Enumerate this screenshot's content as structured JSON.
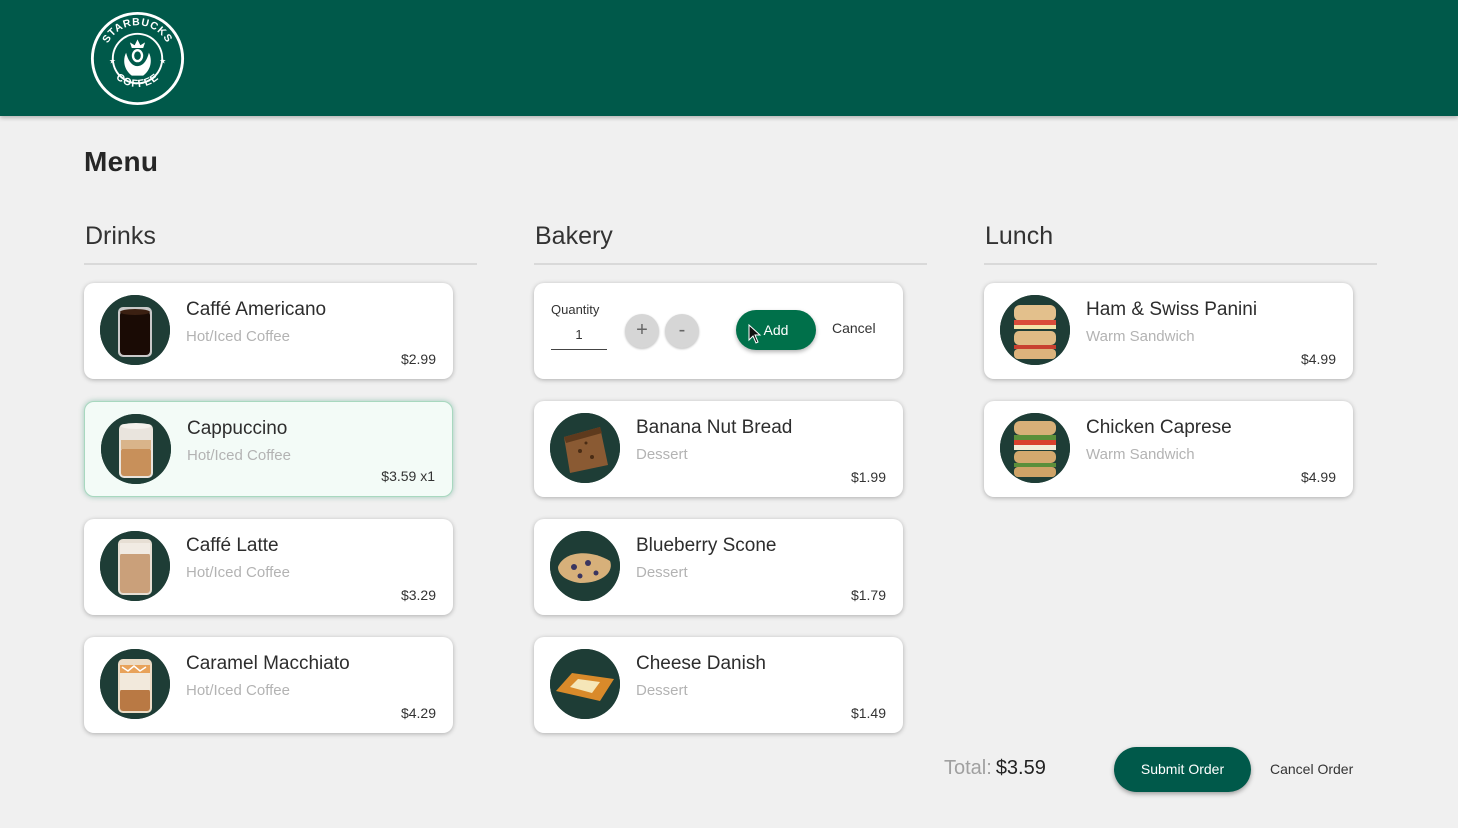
{
  "colors": {
    "header": "#00594a",
    "accent": "#00704a",
    "background": "#f0f0f0"
  },
  "header": {
    "logo_text_top": "STARBUCKS",
    "logo_text_bottom": "COFFEE"
  },
  "page_title": "Menu",
  "columns": [
    {
      "title": "Drinks",
      "items": [
        {
          "name": "Caffé Americano",
          "category": "Hot/Iced Coffee",
          "price": "$2.99",
          "icon": "americano-image"
        },
        {
          "name": "Cappuccino",
          "category": "Hot/Iced Coffee",
          "price": "$3.59 x1",
          "icon": "cappuccino-image",
          "selected": true
        },
        {
          "name": "Caffé Latte",
          "category": "Hot/Iced Coffee",
          "price": "$3.29",
          "icon": "latte-image"
        },
        {
          "name": "Caramel Macchiato",
          "category": "Hot/Iced Coffee",
          "price": "$4.29",
          "icon": "macchiato-image"
        }
      ]
    },
    {
      "title": "Bakery",
      "quantity_editor": {
        "label": "Quantity",
        "value": "1",
        "plus": "+",
        "minus": "-",
        "add": "Add",
        "cancel": "Cancel"
      },
      "items": [
        {
          "name": "Banana Nut Bread",
          "category": "Dessert",
          "price": "$1.99",
          "icon": "banana-bread-image"
        },
        {
          "name": "Blueberry Scone",
          "category": "Dessert",
          "price": "$1.79",
          "icon": "scone-image"
        },
        {
          "name": "Cheese Danish",
          "category": "Dessert",
          "price": "$1.49",
          "icon": "danish-image"
        }
      ]
    },
    {
      "title": "Lunch",
      "items": [
        {
          "name": "Ham & Swiss Panini",
          "category": "Warm Sandwich",
          "price": "$4.99",
          "icon": "panini-image"
        },
        {
          "name": "Chicken Caprese",
          "category": "Warm Sandwich",
          "price": "$4.99",
          "icon": "caprese-image"
        }
      ]
    }
  ],
  "footer": {
    "total_label": "Total:",
    "total_value": "$3.59",
    "submit": "Submit Order",
    "cancel": "Cancel Order"
  }
}
